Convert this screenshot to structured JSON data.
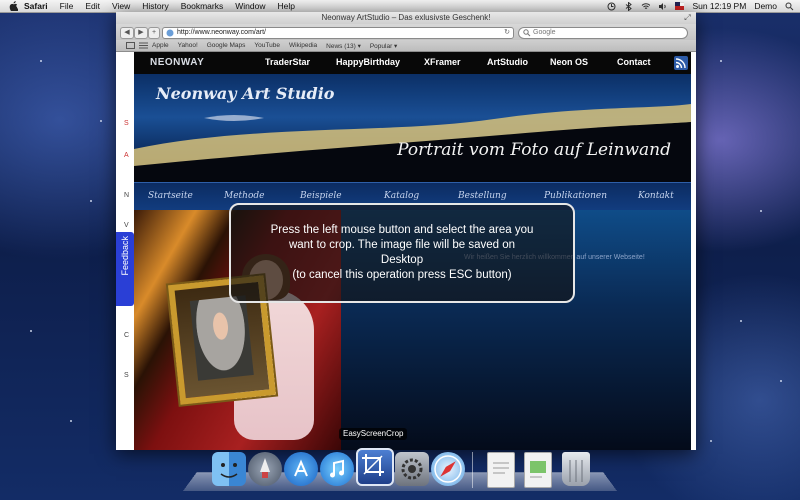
{
  "menubar": {
    "app_name": "Safari",
    "items": [
      "File",
      "Edit",
      "View",
      "History",
      "Bookmarks",
      "Window",
      "Help"
    ],
    "clock": "Sun 12:19 PM",
    "user": "Demo"
  },
  "browser": {
    "window_title": "Neonway ArtStudio – Das exlusivste Geschenk!",
    "url": "http://www.neonway.com/art/",
    "search_placeholder": "Google",
    "bookmarks": [
      "Apple",
      "Yahoo!",
      "Google Maps",
      "YouTube",
      "Wikipedia",
      "News (13) ▾",
      "Popular ▾"
    ]
  },
  "site": {
    "logo": "NEONWAY",
    "nav": [
      "TraderStar",
      "HappyBirthday",
      "XFramer",
      "ArtStudio",
      "Neon OS",
      "Contact"
    ],
    "banner_title": "Neonway Art Studio",
    "banner_subtitle": "Portrait vom Foto auf Leinwand",
    "subnav": [
      "Startseite",
      "Methode",
      "Beispiele",
      "Katalog",
      "Bestellung",
      "Publikationen",
      "Kontakt"
    ],
    "welcome_text": "Wir heißen Sie herzlich willkommen auf unserer Webseite!",
    "feedback_tab": "Feedback"
  },
  "overlay": {
    "line1": "Press the left mouse button and select the area you",
    "line2": "want to crop. The image file will be saved on",
    "line3": "Desktop",
    "line4": "(to cancel this operation press ESC button)",
    "app_label": "EasyScreenCrop"
  },
  "dock": {
    "icons": [
      "finder-icon",
      "launchpad-icon",
      "app-store-icon",
      "itunes-icon",
      "easyscreencrop-icon",
      "system-preferences-icon",
      "safari-icon",
      "document-icon",
      "document-icon-2",
      "trash-icon"
    ]
  }
}
